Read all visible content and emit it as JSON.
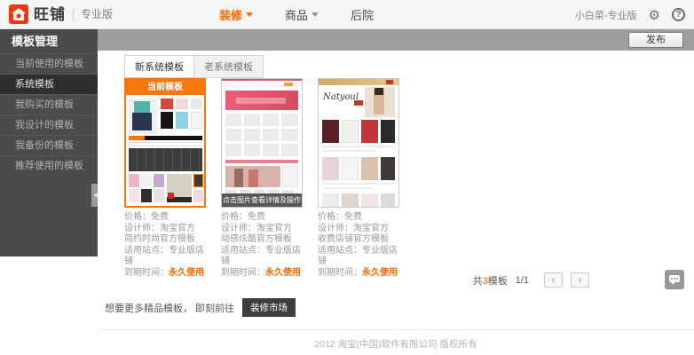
{
  "topbar": {
    "logo_text": "旺铺",
    "edition": "专业版",
    "nav": [
      {
        "label": "装修"
      },
      {
        "label": "商品"
      },
      {
        "label": "后院"
      }
    ],
    "user_name": "小白菜-专业版"
  },
  "icons": {
    "gear": "⚙",
    "help": "?",
    "collapse": "◂",
    "prev": "‹",
    "next": "›"
  },
  "sidebar": {
    "title": "模板管理",
    "items": [
      {
        "label": "当前使用的模板"
      },
      {
        "label": "系统模板"
      },
      {
        "label": "我购买的模板"
      },
      {
        "label": "我设计的模板"
      },
      {
        "label": "我备份的模板"
      },
      {
        "label": "推荐使用的模板"
      }
    ]
  },
  "toolbar": {
    "publish_label": "发布"
  },
  "tabs": [
    {
      "label": "新系统模板"
    },
    {
      "label": "老系统模板"
    }
  ],
  "card_labels": {
    "price": "价格：",
    "designer": "设计师：",
    "site": "适用站点：",
    "expire": "到期时间："
  },
  "cards": [
    {
      "badge": "当前模板",
      "price": "免费",
      "designer": "淘宝官方",
      "desc": "简约时尚官方模板",
      "site": "专业版店铺",
      "expire": "永久使用"
    },
    {
      "overlay": "点击图片查看详情及操作",
      "price": "免费",
      "designer": "淘宝官方",
      "desc": "动感炫酷官方模板",
      "site": "专业版店铺",
      "expire": "永久使用"
    },
    {
      "brand": "Natyoul",
      "price": "免费",
      "designer": "淘宝官方",
      "desc": "收费店铺官方模板",
      "site": "专业版店铺",
      "expire": "永久使用"
    }
  ],
  "pagination": {
    "total_prefix": "共",
    "total_count": "3",
    "total_suffix": "模板",
    "page": "1/1"
  },
  "promo": {
    "text": "想要更多精品模板， 即刻前往",
    "button_label": "装修市场"
  },
  "footer": {
    "copyright": "2012 淘宝(中国)软件有限公司 版权所有"
  }
}
